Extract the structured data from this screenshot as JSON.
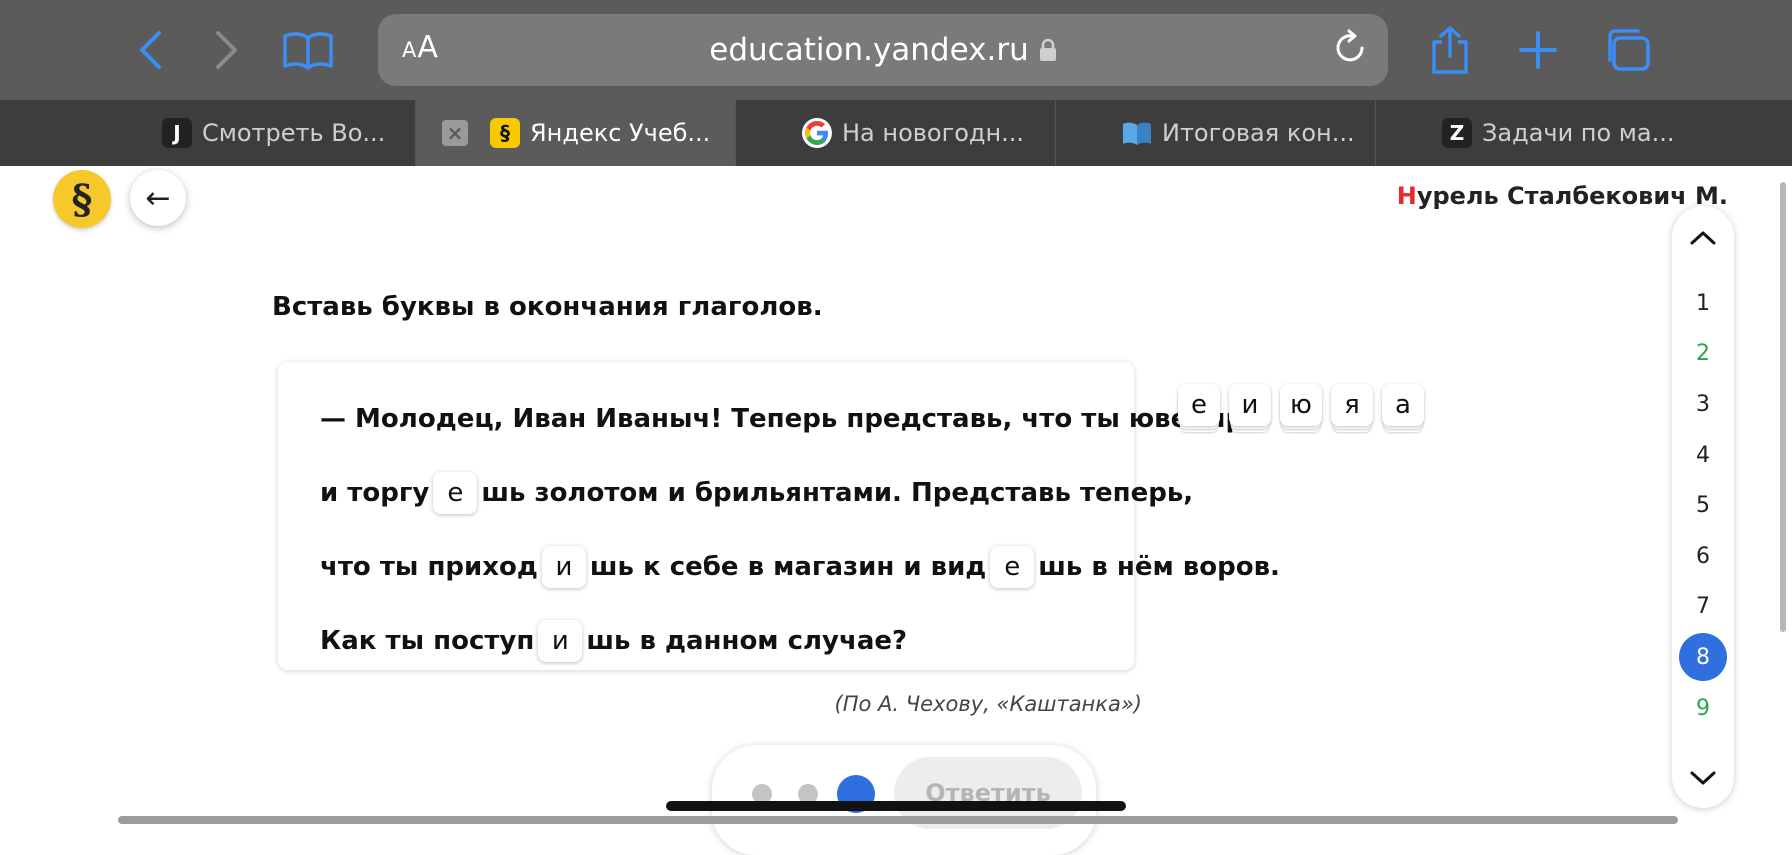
{
  "browser": {
    "text_size_label": "AA",
    "url": "education.yandex.ru",
    "colors": {
      "toolbar": "#5b5b5b",
      "accent_icons": "#3a8ef6",
      "tabs_bg": "#3d3d3d"
    }
  },
  "tabs": [
    {
      "favicon": "J",
      "title": "Смотреть Во..."
    },
    {
      "favicon": "§",
      "title": "Яндекс Учеб...",
      "active": true
    },
    {
      "favicon": "G",
      "title": "На новогодн..."
    },
    {
      "favicon": "book",
      "title": "Итоговая кон..."
    },
    {
      "favicon": "Z",
      "title": "Задачи по ма..."
    }
  ],
  "page": {
    "logo_symbol": "§",
    "back_arrow": "←",
    "user": {
      "first_letter": "Н",
      "rest": "урель Сталбекович М."
    },
    "task_title": "Вставь буквы в окончания глаголов.",
    "text_lines": [
      {
        "parts": [
          {
            "t": "— Молодец, Иван Иваныч! Теперь представь, что ты ювелир"
          }
        ]
      },
      {
        "parts": [
          {
            "t": "и торгу"
          },
          {
            "slot": "е"
          },
          {
            "t": "шь золотом и брильянтами. Представь теперь,"
          }
        ]
      },
      {
        "parts": [
          {
            "t": "что ты приход"
          },
          {
            "slot": "и"
          },
          {
            "t": "шь к себе в магазин и вид"
          },
          {
            "slot": "е"
          },
          {
            "t": "шь в нём воров."
          }
        ]
      },
      {
        "parts": [
          {
            "t": "Как ты поступ"
          },
          {
            "slot": "и"
          },
          {
            "t": "шь в данном случае?"
          }
        ]
      }
    ],
    "source": "(По А. Чехову, «Каштанка»)",
    "letter_options": [
      "е",
      "и",
      "ю",
      "я",
      "а"
    ]
  },
  "question_nav": {
    "items": [
      {
        "n": "1",
        "state": "default"
      },
      {
        "n": "2",
        "state": "done"
      },
      {
        "n": "3",
        "state": "default"
      },
      {
        "n": "4",
        "state": "default"
      },
      {
        "n": "5",
        "state": "default"
      },
      {
        "n": "6",
        "state": "default"
      },
      {
        "n": "7",
        "state": "default"
      },
      {
        "n": "8",
        "state": "current"
      },
      {
        "n": "9",
        "state": "done"
      }
    ],
    "colors": {
      "done": "#2ea44f",
      "current": "#2f6fe0"
    }
  },
  "bottom": {
    "answer_label": "Ответить",
    "steps_total": 3,
    "step_current": 3
  }
}
